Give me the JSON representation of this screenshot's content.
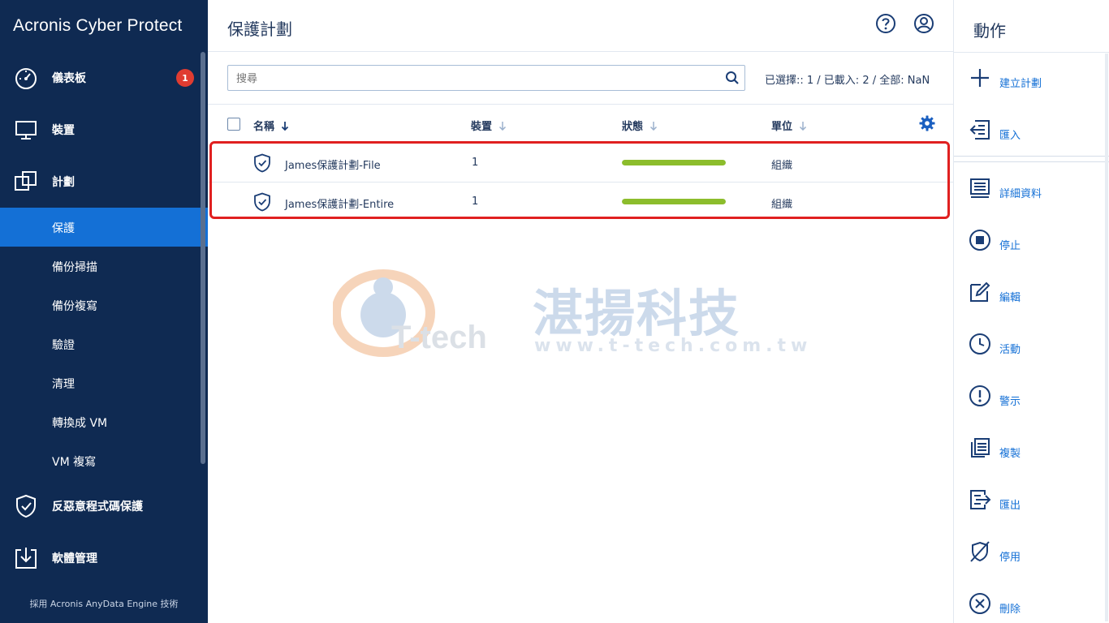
{
  "sidebar": {
    "brand_primary": "Acronis",
    "brand_secondary": "Cyber Protect",
    "dashboard": {
      "label": "儀表板",
      "badge": "1"
    },
    "devices": {
      "label": "裝置"
    },
    "plans": {
      "label": "計劃"
    },
    "sub_items": [
      "保護",
      "備份掃描",
      "備份複寫",
      "驗證",
      "清理",
      "轉換成 VM",
      "VM 複寫"
    ],
    "antimalware": {
      "label": "反惡意程式碼保護"
    },
    "software": {
      "label": "軟體管理"
    },
    "footer": "採用 Acronis AnyData Engine 技術"
  },
  "header": {
    "title": "保護計劃"
  },
  "search": {
    "placeholder": "搜尋"
  },
  "selection_info": "已選擇:: 1 / 已載入: 2 / 全部: NaN",
  "table": {
    "columns": [
      "名稱",
      "裝置",
      "狀態",
      "單位"
    ],
    "rows": [
      {
        "name": "James保護計劃-File",
        "devices": "1",
        "status_progress": 1.0,
        "unit": "組織"
      },
      {
        "name": "James保護計劃-Entire",
        "devices": "1",
        "status_progress": 1.0,
        "unit": "組織"
      }
    ]
  },
  "watermark": {
    "chinese": "湛揚科技",
    "brand": "T-tech",
    "url": "www.t-tech.com.tw"
  },
  "actions": {
    "title": "動作",
    "items": [
      "建立計劃",
      "匯入",
      "詳細資料",
      "停止",
      "編輯",
      "活動",
      "警示",
      "複製",
      "匯出",
      "停用",
      "刪除"
    ]
  },
  "colors": {
    "sidebar_bg": "#0f2a52",
    "active_item": "#1470d6",
    "badge": "#e03c31",
    "progress_fill": "#8cbd2c",
    "highlight_border": "#e02020",
    "link": "#1470d6"
  }
}
